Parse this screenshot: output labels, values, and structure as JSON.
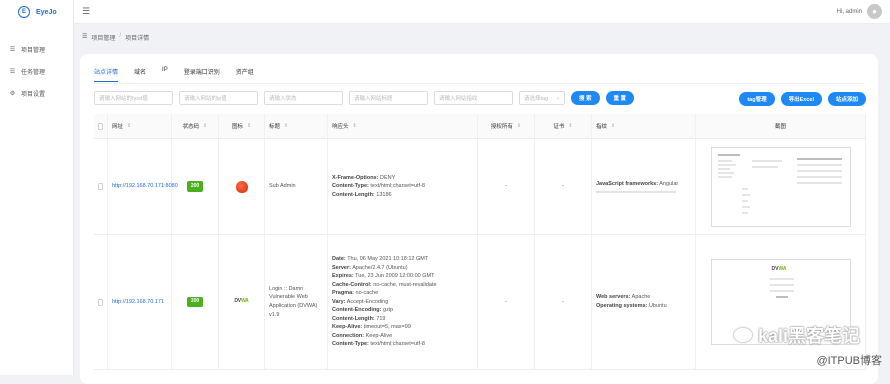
{
  "app": {
    "logo_letter": "E",
    "name": "EyeJo"
  },
  "sidebar": {
    "items": [
      {
        "icon": "list-icon",
        "glyph": "☰",
        "label": "项目管理"
      },
      {
        "icon": "task-icon",
        "glyph": "☰",
        "label": "任务管理"
      },
      {
        "icon": "gear-icon",
        "glyph": "⚙",
        "label": "项目设置"
      }
    ]
  },
  "header": {
    "user_label": "Hi, admin"
  },
  "breadcrumb": {
    "parent": "项目管理",
    "separator": "/",
    "current": "项目详情"
  },
  "tabs": [
    {
      "label": "站点详情",
      "active": true
    },
    {
      "label": "域名",
      "active": false
    },
    {
      "label": "IP",
      "active": false
    },
    {
      "label": "登录端口识别",
      "active": false
    },
    {
      "label": "资产组",
      "active": false
    }
  ],
  "filters": {
    "inputs": [
      {
        "placeholder": "请输入网站的host值"
      },
      {
        "placeholder": "请输入网站的ip值"
      },
      {
        "placeholder": "请输入状态"
      },
      {
        "placeholder": "请输入网站标题"
      },
      {
        "placeholder": "请输入网站指纹"
      }
    ],
    "select_placeholder": "请选择tag",
    "search_label": "搜 索",
    "reset_label": "重 置"
  },
  "actions": {
    "tag_label": "tag管理",
    "export_label": "导出Excel",
    "add_label": "站点添加"
  },
  "table": {
    "columns": [
      "网址",
      "状态码",
      "图标",
      "标题",
      "响应头",
      "授权所有",
      "证书",
      "指纹",
      "截图"
    ],
    "rows": [
      {
        "url": "http://192.168.70.171:8080",
        "status": "200",
        "title": "Sub Admin",
        "headers": [
          {
            "key": "X-Frame-Options:",
            "value": " DENY"
          },
          {
            "key": "Content-Type:",
            "value": " text/html;charset=utf-8"
          },
          {
            "key": "Content-Length:",
            "value": " 13186"
          }
        ],
        "owner": "-",
        "cert": "-",
        "fingerprint": [
          {
            "key": "JavaScript frameworks:",
            "value": " Angular"
          }
        ]
      },
      {
        "url": "http://192.168.70.171",
        "status": "200",
        "title": "Login :: Damn Vulnerable Web Application (DVWA) v1.9",
        "headers": [
          {
            "key": "Date:",
            "value": " Thu, 06 May 2021 10:18:12 GMT"
          },
          {
            "key": "Server:",
            "value": " Apache/2.4.7 (Ubuntu)"
          },
          {
            "key": "Expires:",
            "value": " Tue, 23 Jun 2009 12:00:00 GMT"
          },
          {
            "key": "Cache-Control:",
            "value": " no-cache, must-revalidate"
          },
          {
            "key": "Pragma:",
            "value": " no-cache"
          },
          {
            "key": "Vary:",
            "value": " Accept-Encoding"
          },
          {
            "key": "Content-Encoding:",
            "value": " gzip"
          },
          {
            "key": "Content-Length:",
            "value": " 719"
          },
          {
            "key": "Keep-Alive:",
            "value": " timeout=5, max=99"
          },
          {
            "key": "Connection:",
            "value": " Keep-Alive"
          },
          {
            "key": "Content-Type:",
            "value": " text/html;charset=utf-8"
          }
        ],
        "owner": "-",
        "cert": "-",
        "fingerprint": [
          {
            "key": "Web servers:",
            "value": " Apache"
          },
          {
            "key": "Operating systems:",
            "value": " Ubuntu"
          }
        ]
      }
    ]
  },
  "favicons": {
    "dvwa_prefix": "DV",
    "dvwa_suffix": "WA"
  },
  "watermark": {
    "main": "kali黑客笔记",
    "sub": "@ITPUB博客"
  },
  "colors": {
    "accent": "#1e6bd6",
    "button": "#1e88f5",
    "status_ok": "#4caf1e"
  }
}
